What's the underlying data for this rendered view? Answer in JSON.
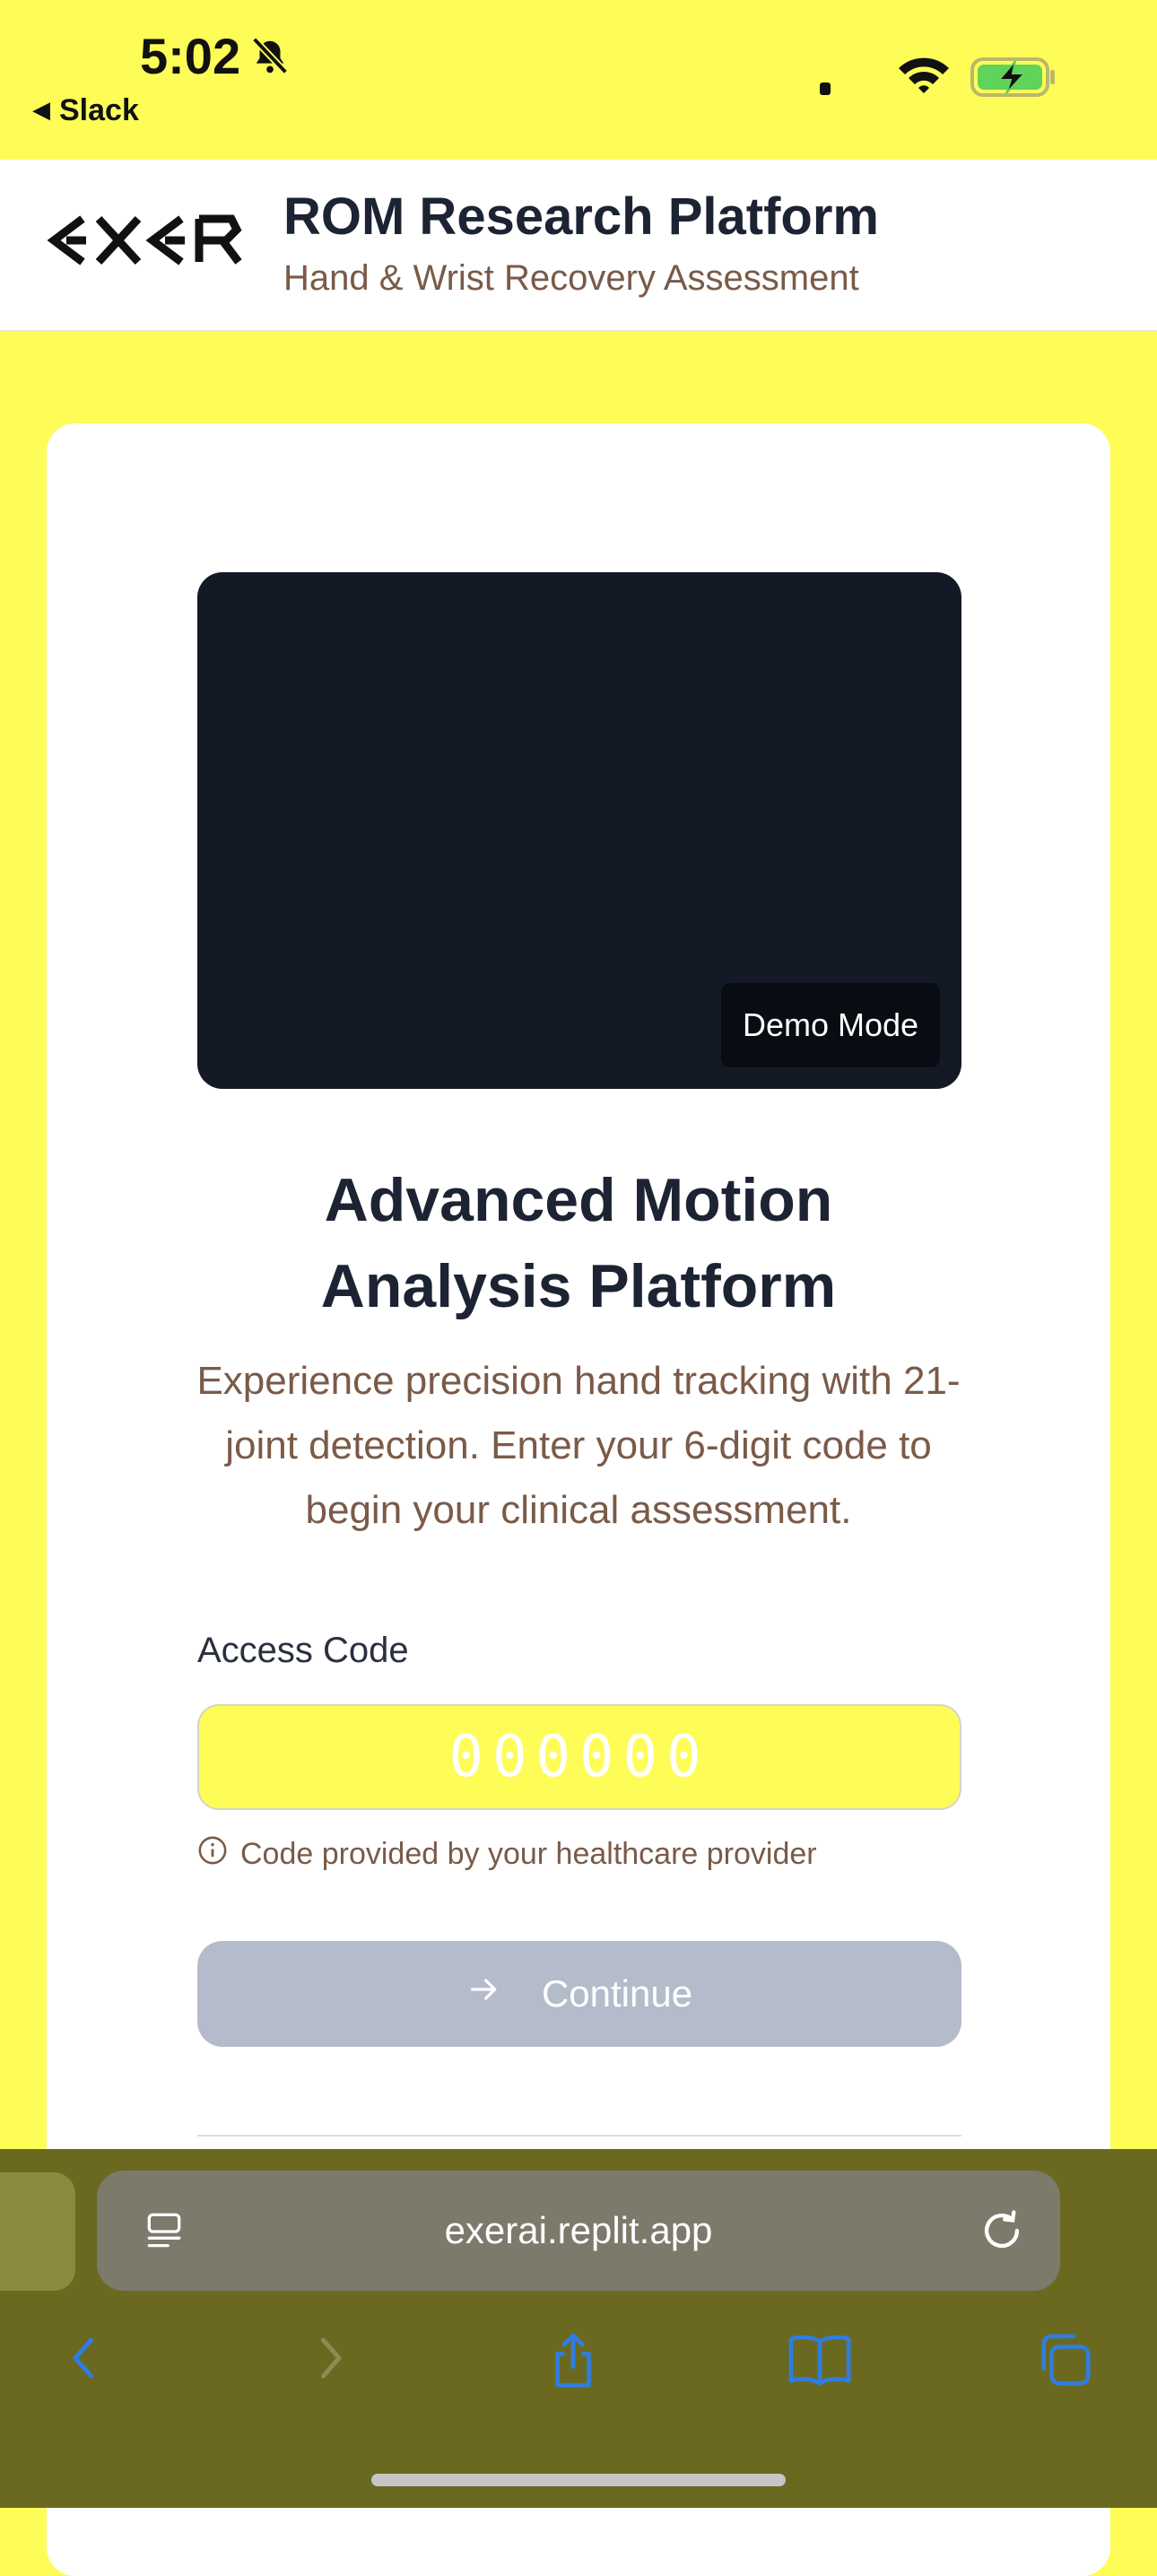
{
  "status_bar": {
    "time": "5:02",
    "back_app": "Slack"
  },
  "header": {
    "logo_text": "EXER",
    "title": "ROM Research Platform",
    "subtitle": "Hand & Wrist Recovery Assessment"
  },
  "card": {
    "video_badge": "Demo Mode",
    "title_line1": "Advanced Motion",
    "title_line2": "Analysis Platform",
    "description": "Experience precision hand tracking with 21-joint detection. Enter your 6-digit code to begin your clinical assessment.",
    "access_code_label": "Access Code",
    "access_code_value": "",
    "access_code_placeholder": "000000",
    "hint": "Code provided by your healthcare provider",
    "continue_label": "Continue"
  },
  "browser": {
    "url": "exerai.replit.app"
  },
  "colors": {
    "page_background": "#FEFD58",
    "title_text": "#1c2333",
    "secondary_text": "#7a5a48",
    "button_disabled": "#b4bccb",
    "toolbar_icon_active": "#2f7de1",
    "battery_fill": "#5fd35a"
  }
}
